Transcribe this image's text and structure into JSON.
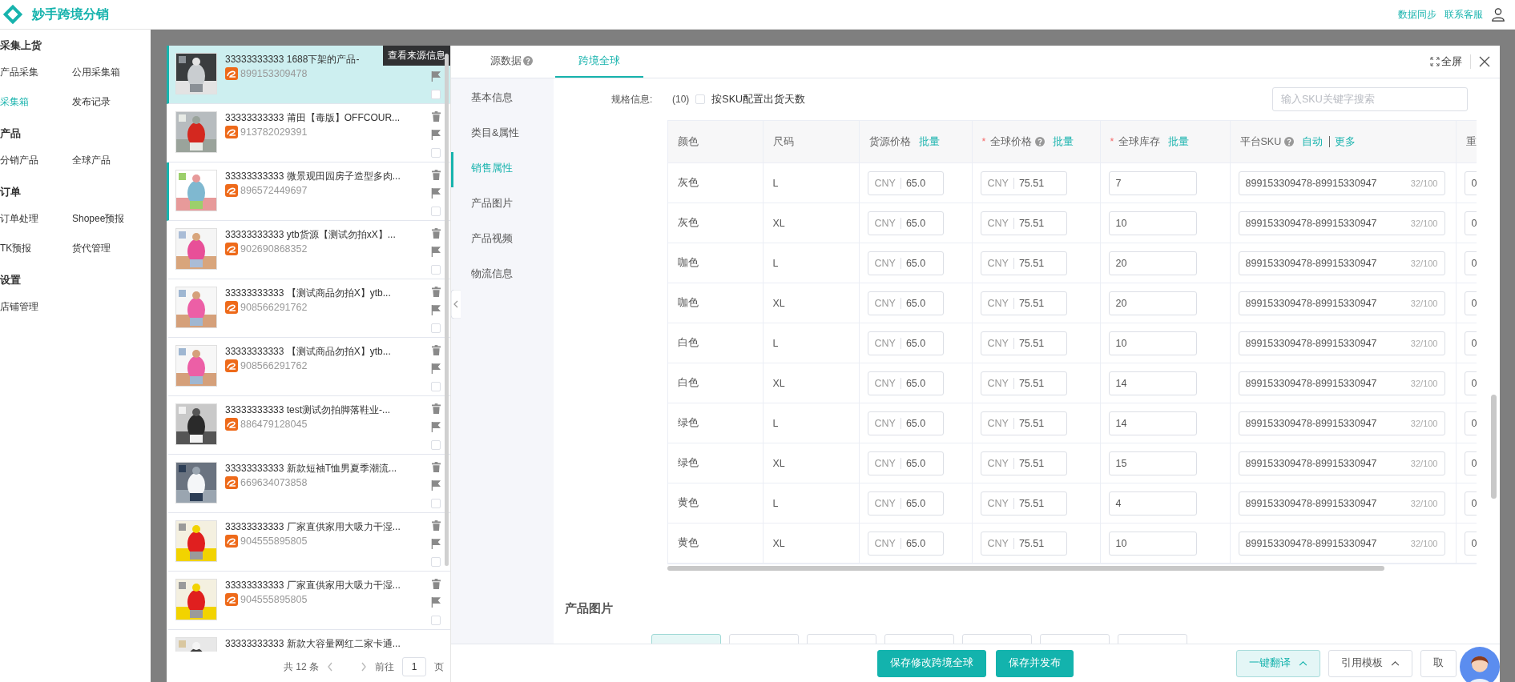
{
  "header": {
    "brand": "妙手跨境分销",
    "links": [
      "数据同步",
      "联系客服"
    ]
  },
  "sidebar": {
    "groups": [
      {
        "title": "采集上货",
        "items": [
          {
            "label": "产品采集",
            "selected": false
          },
          {
            "label": "公用采集箱",
            "selected": false
          },
          {
            "label": "采集箱",
            "selected": true
          },
          {
            "label": "发布记录",
            "selected": false
          }
        ]
      },
      {
        "title": "产品",
        "items": [
          {
            "label": "分销产品",
            "selected": false
          },
          {
            "label": "全球产品",
            "selected": false
          }
        ]
      },
      {
        "title": "订单",
        "items": [
          {
            "label": "订单处理",
            "selected": false
          },
          {
            "label": "Shopee预报",
            "selected": false
          },
          {
            "label": "TK预报",
            "selected": false
          },
          {
            "label": "货代管理",
            "selected": false
          }
        ]
      },
      {
        "title": "设置",
        "items": [
          {
            "label": "店铺管理",
            "selected": false
          }
        ]
      }
    ]
  },
  "products": [
    {
      "title": "33333333333 1688下架的产品-",
      "id": "899153309478",
      "selected": true,
      "marked": true,
      "checked": false,
      "tooltip": "查看来源信息"
    },
    {
      "title": "33333333333 莆田【毒版】OFFCOUR...",
      "id": "913782029391",
      "selected": false,
      "marked": false,
      "checked": false
    },
    {
      "title": "33333333333 微景观田园房子造型多肉...",
      "id": "896572449697",
      "selected": false,
      "marked": true,
      "checked": false
    },
    {
      "title": "33333333333 ytb货源【测试勿拍xX】...",
      "id": "902690868352",
      "selected": false,
      "marked": false,
      "checked": false
    },
    {
      "title": "33333333333 【测试商品勿拍X】ytb...",
      "id": "908566291762",
      "selected": false,
      "marked": false,
      "checked": false
    },
    {
      "title": "33333333333 【测试商品勿拍X】ytb...",
      "id": "908566291762",
      "selected": false,
      "marked": false,
      "checked": false
    },
    {
      "title": "33333333333 test测试勿拍脚落鞋业-...",
      "id": "886479128045",
      "selected": false,
      "marked": false,
      "checked": false
    },
    {
      "title": "33333333333 新款短袖T恤男夏季潮流...",
      "id": "669634073858",
      "selected": false,
      "marked": false,
      "checked": false
    },
    {
      "title": "33333333333 厂家直供家用大吸力干湿...",
      "id": "904555895805",
      "selected": false,
      "marked": false,
      "checked": false
    },
    {
      "title": "33333333333 厂家直供家用大吸力干湿...",
      "id": "904555895805",
      "selected": false,
      "marked": false,
      "checked": false
    },
    {
      "title": "33333333333 新款大容量网红二家卡通...",
      "selected": false,
      "marked": false
    }
  ],
  "pagination": {
    "total": "共 12 条",
    "goto": "前往",
    "page": "1",
    "unit": "页"
  },
  "tabs": [
    {
      "label": "源数据",
      "selected": false,
      "help": true
    },
    {
      "label": "跨境全球",
      "selected": true,
      "help": false
    }
  ],
  "fullscreen": "全屏",
  "nav": [
    {
      "label": "基本信息",
      "selected": false
    },
    {
      "label": "类目&属性",
      "selected": false
    },
    {
      "label": "销售属性",
      "selected": true
    },
    {
      "label": "产品图片",
      "selected": false
    },
    {
      "label": "产品视频",
      "selected": false
    },
    {
      "label": "物流信息",
      "selected": false
    }
  ],
  "spec": {
    "label": "规格信息:",
    "count": "(10)",
    "checkbox": {
      "label": "按SKU配置出货天数",
      "checked": false
    },
    "search": {
      "placeholder": "输入SKU关键字搜索"
    }
  },
  "table": {
    "columns": [
      {
        "label": "颜色",
        "help": false
      },
      {
        "label": "尺码",
        "help": false
      },
      {
        "label": "货源价格",
        "help": false,
        "actions": [
          "批量"
        ]
      },
      {
        "mark": "*",
        "label": "全球价格",
        "help": true,
        "actions": [
          "批量"
        ]
      },
      {
        "mark": "*",
        "label": "全球库存",
        "help": false,
        "actions": [
          "批量"
        ]
      },
      {
        "label": "平台SKU",
        "help": true,
        "actions": [
          "自动",
          "更多"
        ]
      },
      {
        "label": "重",
        "help": false
      }
    ],
    "rows": [
      {
        "shade": "灰色",
        "size": "L",
        "source_currency": "CNY",
        "source_price": "65.0",
        "global_currency": "CNY",
        "global_price": "75.51",
        "stock": "7",
        "sku": "899153309478-89915330947",
        "sku_count": "32/100",
        "column_7": "0"
      },
      {
        "shade": "灰色",
        "size": "XL",
        "source_currency": "CNY",
        "source_price": "65.0",
        "global_currency": "CNY",
        "global_price": "75.51",
        "stock": "10",
        "sku": "899153309478-89915330947",
        "sku_count": "32/100",
        "column_7": "0"
      },
      {
        "shade": "咖色",
        "size": "L",
        "source_currency": "CNY",
        "source_price": "65.0",
        "global_currency": "CNY",
        "global_price": "75.51",
        "stock": "20",
        "sku": "899153309478-89915330947",
        "sku_count": "32/100",
        "column_7": "0"
      },
      {
        "shade": "咖色",
        "size": "XL",
        "source_currency": "CNY",
        "source_price": "65.0",
        "global_currency": "CNY",
        "global_price": "75.51",
        "stock": "20",
        "sku": "899153309478-89915330947",
        "sku_count": "32/100",
        "column_7": "0"
      },
      {
        "shade": "白色",
        "size": "L",
        "source_currency": "CNY",
        "source_price": "65.0",
        "global_currency": "CNY",
        "global_price": "75.51",
        "stock": "10",
        "sku": "899153309478-89915330947",
        "sku_count": "32/100",
        "column_7": "0"
      },
      {
        "shade": "白色",
        "size": "XL",
        "source_currency": "CNY",
        "source_price": "65.0",
        "global_currency": "CNY",
        "global_price": "75.51",
        "stock": "14",
        "sku": "899153309478-89915330947",
        "sku_count": "32/100",
        "column_7": "0"
      },
      {
        "shade": "绿色",
        "size": "L",
        "source_currency": "CNY",
        "source_price": "65.0",
        "global_currency": "CNY",
        "global_price": "75.51",
        "stock": "14",
        "sku": "899153309478-89915330947",
        "sku_count": "32/100",
        "column_7": "0"
      },
      {
        "shade": "绿色",
        "size": "XL",
        "source_currency": "CNY",
        "source_price": "65.0",
        "global_currency": "CNY",
        "global_price": "75.51",
        "stock": "15",
        "sku": "899153309478-89915330947",
        "sku_count": "32/100",
        "column_7": "0"
      },
      {
        "shade": "黄色",
        "size": "L",
        "source_currency": "CNY",
        "source_price": "65.0",
        "global_currency": "CNY",
        "global_price": "75.51",
        "stock": "4",
        "sku": "899153309478-89915330947",
        "sku_count": "32/100",
        "column_7": "0"
      },
      {
        "shade": "黄色",
        "size": "XL",
        "source_currency": "CNY",
        "source_price": "65.0",
        "global_currency": "CNY",
        "global_price": "75.51",
        "stock": "10",
        "sku": "899153309478-89915330947",
        "sku_count": "32/100",
        "column_7": "0"
      }
    ]
  },
  "section": {
    "title": "产品图片"
  },
  "footer": {
    "buttons": [
      {
        "label": "保存修改跨境全球",
        "kind": "primary"
      },
      {
        "label": "保存并发布",
        "kind": "primary"
      },
      {
        "label": "一键翻译",
        "kind": "active-dropdown"
      },
      {
        "label": "引用模板",
        "kind": "dropdown"
      },
      {
        "label": "取",
        "kind": "plain"
      }
    ]
  }
}
